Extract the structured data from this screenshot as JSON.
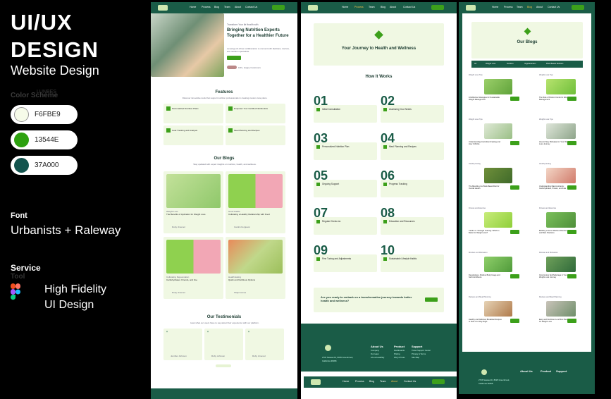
{
  "header": {
    "title_line1": "UI/UX",
    "title_line2": "DESIGN",
    "subtitle": "Website Design"
  },
  "color_scheme": {
    "label": "Color Scheme",
    "overlap": "LUNBES",
    "swatches": [
      {
        "hex": "F6FBE9",
        "color": "#F6FBE9"
      },
      {
        "hex": "13544E",
        "color": "#2da10f"
      },
      {
        "hex": "37A000",
        "color": "#13544E"
      }
    ]
  },
  "font": {
    "label": "Font",
    "value": "Urbanists + Raleway"
  },
  "service": {
    "label": "Service",
    "tool_label": "Tool",
    "line1": "High Fidelity",
    "line2": "UI Design"
  },
  "nav": [
    "Home",
    "Process",
    "Blog",
    "Team",
    "About",
    "Contact Us"
  ],
  "nav_button": "Login",
  "page1": {
    "hero_tag": "Transform Your ✿ Health with",
    "hero_title": "Bringing Nutrition Experts Together for a Healthier Future",
    "hero_sub": "Leverage AI-driven collaboration to connect with dietitians, doctors, and nutrition specialists.",
    "hero_btn": "Get Started",
    "hero_users": "10K+ Happy Customers",
    "features_title": "Features",
    "features_sub": "Discover innovative tools that support nutrition professionals in creating custom care plans.",
    "features": [
      "Personalized Nutrition Plans",
      "Empower Your Certified Nutritionists",
      "Goal Tracking and Analysis",
      "Meal Planning and Recipes"
    ],
    "blogs_title": "Our Blogs",
    "blogs_sub": "Stay updated with expert insights on nutrition, health, and wellness.",
    "blogs": [
      {
        "tag": "Weight Loss",
        "title": "The Benefits of Hydration for Weight Loss",
        "author": "Ruby Jimenez"
      },
      {
        "tag": "Good Habits",
        "title": "Cultivating a Healthy Relationship with Food",
        "author": "Carolin Ferguson"
      },
      {
        "tag": "Cultivating Rejuvenation",
        "title": "Carbohydrates: Friends, and Foe",
        "author": "Ruby Jimenez"
      },
      {
        "tag": "Health Eating",
        "title": "Quick and Nutritious Options",
        "author": "Shaji Gomes"
      }
    ],
    "testimonials_title": "Our Testimonials",
    "testimonials_sub": "Hear what our users have to say about their experience with our platform.",
    "testimonials": [
      "Jennifer Johnson",
      "Ruby Johnson",
      "Ruby Jimenez"
    ]
  },
  "page2": {
    "banner_title": "Your Journey to Health and Wellness",
    "how_title": "How It Works",
    "steps": [
      {
        "n": "01",
        "t": "Initial Consultation"
      },
      {
        "n": "02",
        "t": "Assessing Your Needs"
      },
      {
        "n": "03",
        "t": "Personalized Nutrition Plan"
      },
      {
        "n": "04",
        "t": "Meal Planning and Recipes"
      },
      {
        "n": "05",
        "t": "Ongoing Support"
      },
      {
        "n": "06",
        "t": "Progress Tracking"
      },
      {
        "n": "07",
        "t": "Regular Check-ins"
      },
      {
        "n": "08",
        "t": "Education and Resources"
      },
      {
        "n": "09",
        "t": "Fine Tuning and Adjustments"
      },
      {
        "n": "10",
        "t": "Sustainable Lifestyle Habits"
      }
    ],
    "cta": "Are you ready to embark on a transformative journey towards better health and wellness?",
    "cta_btn": "Get Started",
    "footer_address": "2715 Nassau Dr, 8025 Greenbrook, California 36068",
    "footer_cols": [
      {
        "title": "About Us",
        "items": [
          "Company",
          "Our team",
          "Life at Healthify"
        ]
      },
      {
        "title": "Product",
        "items": [
          "Dashboards",
          "Pricing",
          "FAQ & Tools"
        ]
      },
      {
        "title": "Support",
        "items": [
          "Ticket Support Center",
          "Privacy & Terms",
          "Site Map"
        ]
      }
    ]
  },
  "page3": {
    "banner_title": "Our Blogs",
    "tabs": [
      "All",
      "Weight Loss",
      "Nutrition",
      "Vegetarianism",
      "Plant Based Nutrition",
      "Biggest Breakthrough"
    ],
    "cards": [
      {
        "tag": "Weight Loss Tips",
        "title": "10 Effective Strategies for Sustainable Weight Management"
      },
      {
        "tag": "Weight Loss Tips",
        "title": "The Role of Portion Control in Weight Management"
      },
      {
        "tag": "Weight Loss Tips",
        "title": "Understanding Intermittent Fasting and How It Works"
      },
      {
        "tag": "Weight Loss Tips",
        "title": "How to Stay Motivated on Your Weight Loss Journey"
      },
      {
        "tag": "Healthy Eating",
        "title": "The Benefits of a Plant-Based Diet for Overall Health"
      },
      {
        "tag": "Healthy Eating",
        "title": "Understanding Macronutrients: Carbohydrates, Protein, and Fats"
      },
      {
        "tag": "Fitness and Exercise",
        "title": "Cardio vs. Strength Training: Which Is Better for Weight Loss?"
      },
      {
        "tag": "Fitness and Exercise",
        "title": "Building a Home Workout Routine: Tips and Best Practices"
      },
      {
        "tag": "Mindset and Motivation",
        "title": "Developing a Positive Body Image and Self-Confidence"
      },
      {
        "tag": "Mindset and Motivation",
        "title": "Overcoming Self-Sabotage in Your Weight Loss Journey"
      },
      {
        "tag": "Recipes and Meal Planning",
        "title": "Healthy and Delicious Breakfast Recipes to Start Your Day Right"
      },
      {
        "tag": "Recipes and Meal Planning",
        "title": "Easy and Nutritious Lunchbox Recipes for Weight Loss"
      }
    ],
    "read_more": "Read More"
  }
}
